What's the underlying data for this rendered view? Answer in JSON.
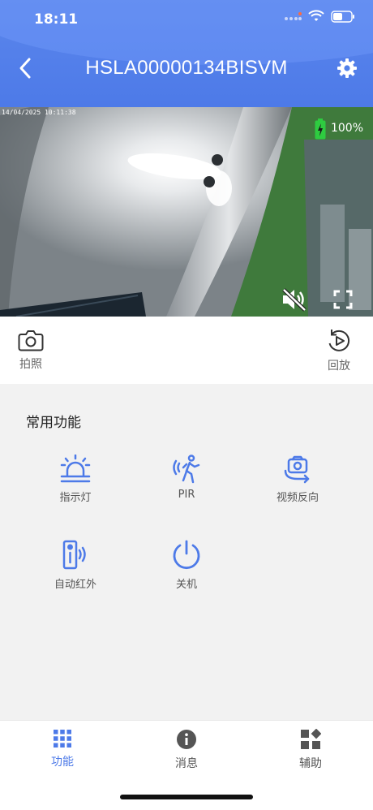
{
  "status_bar": {
    "time": "18:11"
  },
  "nav": {
    "title": "HSLA00000134BISVM"
  },
  "video": {
    "osd_date": "14/04/2025 10:11:38",
    "battery_pct": "100%"
  },
  "quick_actions": {
    "snapshot_label": "拍照",
    "playback_label": "回放"
  },
  "functions": {
    "section_title": "常用功能",
    "items": [
      {
        "label": "指示灯",
        "icon": "siren-light-icon"
      },
      {
        "label": "PIR",
        "icon": "pir-motion-icon"
      },
      {
        "label": "视频反向",
        "icon": "video-flip-icon"
      },
      {
        "label": "自动红外",
        "icon": "auto-infrared-icon"
      },
      {
        "label": "关机",
        "icon": "power-icon"
      }
    ]
  },
  "tabs": [
    {
      "label": "功能",
      "active": true
    },
    {
      "label": "消息",
      "active": false
    },
    {
      "label": "辅助",
      "active": false
    }
  ],
  "colors": {
    "accent": "#4d7ae8",
    "header": "#5b86ec",
    "background": "#f2f2f2"
  }
}
